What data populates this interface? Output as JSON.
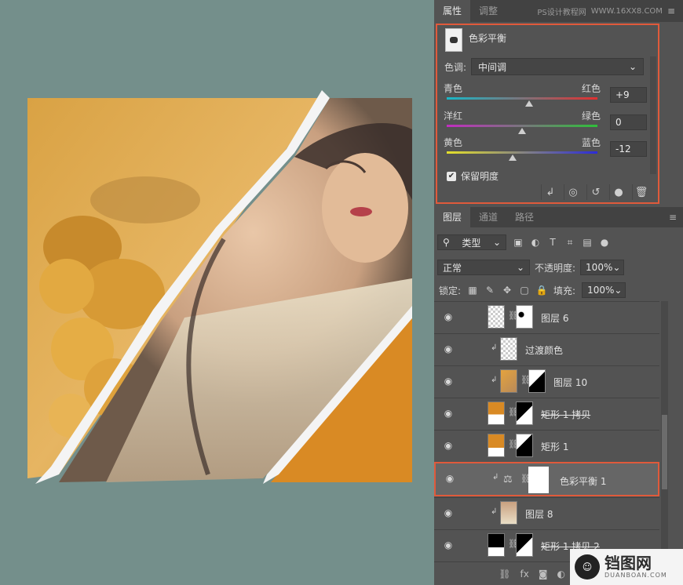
{
  "panel": {
    "tabs": [
      {
        "label": "属性",
        "active": true
      },
      {
        "label": "调整",
        "active": false
      }
    ],
    "watermark": "PS设计教程网",
    "watermark_url": "WWW.16XX8.COM",
    "menu_icon": "hamburger-icon"
  },
  "properties": {
    "title": "色彩平衡",
    "tone_label": "色调:",
    "tone_value": "中间调",
    "sliders": [
      {
        "left": "青色",
        "right": "红色",
        "value": "+9",
        "level": 9
      },
      {
        "left": "洋红",
        "right": "绿色",
        "value": "0",
        "level": 0
      },
      {
        "left": "黄色",
        "right": "蓝色",
        "value": "-12",
        "level": -12
      }
    ],
    "preserve_luminosity": "保留明度",
    "preserve_checked": true,
    "footer_icons": [
      "clip-to-layer-icon",
      "view-previous-state-icon",
      "reset-icon",
      "visibility-icon",
      "trash-icon"
    ]
  },
  "layers_panel": {
    "tabs": [
      {
        "label": "图层",
        "active": true
      },
      {
        "label": "通道",
        "active": false
      },
      {
        "label": "路径",
        "active": false
      }
    ],
    "filter_label": "类型",
    "blend_mode": "正常",
    "opacity_label": "不透明度:",
    "opacity_value": "100%",
    "lock_label": "锁定:",
    "fill_label": "填充:",
    "fill_value": "100%",
    "layers": [
      {
        "name": "图层 6",
        "clipped": false,
        "strike": false,
        "selected": false,
        "thumb": "checker",
        "mask": "white-with-spots"
      },
      {
        "name": "过渡颜色",
        "clipped": true,
        "strike": false,
        "selected": false,
        "thumb": "checker",
        "mask": null
      },
      {
        "name": "图层 10",
        "clipped": true,
        "strike": false,
        "selected": false,
        "thumb": "flowers",
        "mask": "white-with-black"
      },
      {
        "name": "矩形 1 拷贝",
        "clipped": false,
        "strike": true,
        "selected": false,
        "thumb": "orange-shape",
        "mask": "black-with-white"
      },
      {
        "name": "矩形 1",
        "clipped": false,
        "strike": false,
        "selected": false,
        "thumb": "orange-shape",
        "mask": "black-shape"
      },
      {
        "name": "色彩平衡 1",
        "clipped": true,
        "strike": false,
        "selected": true,
        "thumb": "balance-icon",
        "mask": "white"
      },
      {
        "name": "图层 8",
        "clipped": true,
        "strike": false,
        "selected": false,
        "thumb": "portrait",
        "mask": null
      },
      {
        "name": "矩形 1 拷贝 2",
        "clipped": false,
        "strike": true,
        "selected": false,
        "thumb": "black-shape",
        "mask": "black-with-white"
      }
    ],
    "footer_icons": [
      "link-icon",
      "fx-icon",
      "mask-icon",
      "adjustment-icon"
    ]
  },
  "logo": {
    "text_cn": "铛图网",
    "text_en": "DUANBOAN.COM"
  },
  "colors": {
    "accent_border": "#e05a3b",
    "canvas_bg": "#748f8b",
    "panel_bg": "#535353"
  }
}
